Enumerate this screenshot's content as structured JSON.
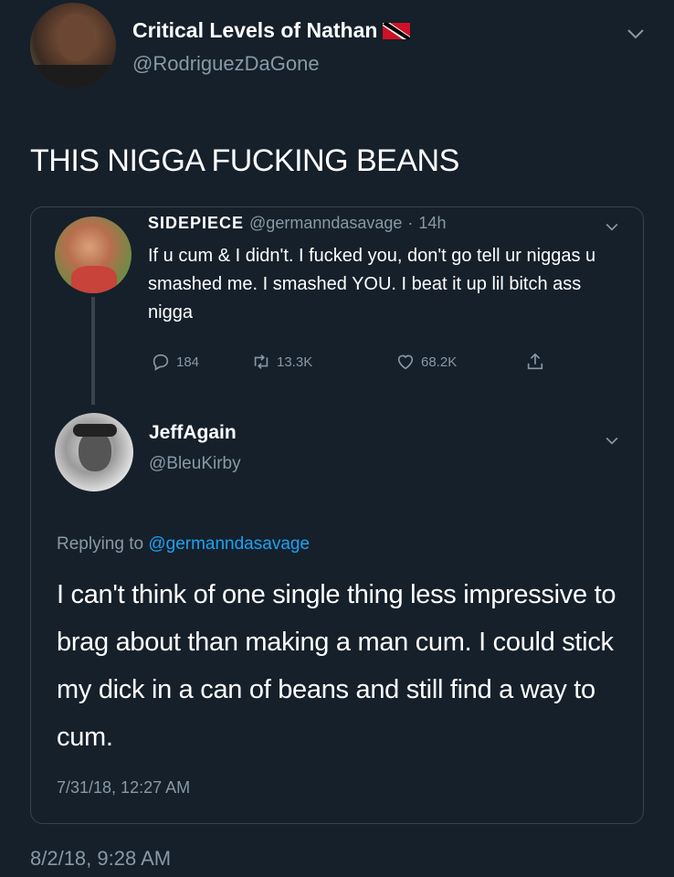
{
  "tweet": {
    "author_name": "Critical Levels of Nathan",
    "author_handle": "@RodriguezDaGone",
    "author_flag_icon": "trinidad-tobago-flag-icon",
    "text": "THIS NIGGA FUCKING BEANS",
    "timestamp": "8/2/18, 9:28 AM"
  },
  "quoted": {
    "parent": {
      "author_name": "SIDEPIECE",
      "author_handle": "@germanndasavage",
      "separator": "·",
      "age": "14h",
      "text": "If u cum & I didn't. I fucked you, don't go tell ur niggas u smashed me. I smashed YOU. I beat it up lil bitch ass nigga",
      "counts": {
        "replies": "184",
        "retweets": "13.3K",
        "likes": "68.2K"
      }
    },
    "reply": {
      "author_name": "JeffAgain",
      "author_handle": "@BleuKirby",
      "replying_prefix": "Replying to",
      "replying_to": "@germanndasavage",
      "text": "I can't think of one single thing less impressive to brag about than making a man cum. I could stick my dick in a can of beans and still find a way to cum.",
      "timestamp": "7/31/18, 12:27 AM"
    }
  },
  "colors": {
    "background": "#15202b",
    "secondary_text": "#8899a6",
    "link": "#1da1f2",
    "border": "#38444d"
  }
}
